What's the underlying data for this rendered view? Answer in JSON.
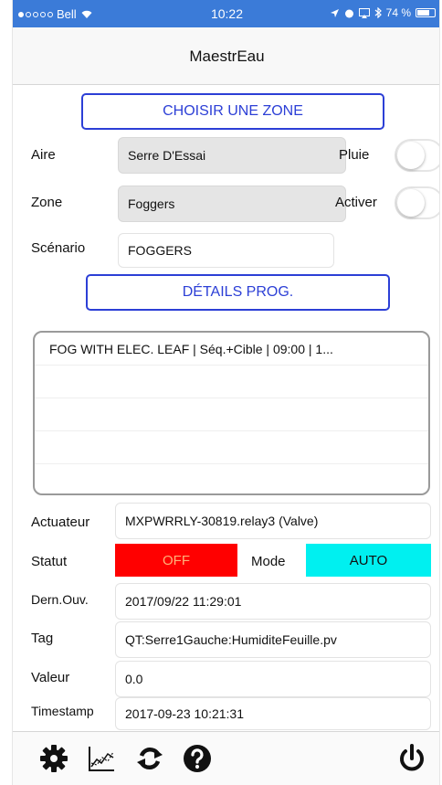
{
  "status_bar": {
    "carrier": "Bell",
    "time": "10:22",
    "battery_text": "74 %",
    "battery_level": 0.74
  },
  "nav": {
    "title": "MaestrEau"
  },
  "buttons": {
    "choose_zone": "CHOISIR UNE ZONE",
    "details": "DÉTAILS PROG."
  },
  "form": {
    "aire_label": "Aire",
    "aire_value": "Serre D'Essai",
    "pluie_label": "Pluie",
    "zone_label": "Zone",
    "zone_value": "Foggers",
    "activer_label": "Activer",
    "scenario_label": "Scénario",
    "scenario_value": "FOGGERS"
  },
  "program_list": {
    "rows": [
      "FOG WITH ELEC. LEAF | Séq.+Cible | 09:00 | 1...",
      "",
      "",
      "",
      ""
    ]
  },
  "details": {
    "actuateur_label": "Actuateur",
    "actuateur_value": "MXPWRRLY-30819.relay3 (Valve)",
    "statut_label": "Statut",
    "statut_value": "OFF",
    "mode_label": "Mode",
    "mode_value": "AUTO",
    "dern_label": "Dern.Ouv.",
    "dern_value": "2017/09/22 11:29:01",
    "tag_label": "Tag",
    "tag_value": "QT:Serre1Gauche:HumiditeFeuille.pv",
    "valeur_label": "Valeur",
    "valeur_value": "0.0",
    "timestamp_label": "Timestamp",
    "timestamp_value": "2017-09-23 10:21:31"
  },
  "colors": {
    "status_bar": "#3b7bd8",
    "accent": "#2c3fd6",
    "off_red": "#ff0000",
    "auto_cyan": "#00f0f0"
  },
  "toolbar": {
    "icons": [
      "gear-icon",
      "chart-icon",
      "refresh-icon",
      "help-icon",
      "power-icon"
    ]
  }
}
